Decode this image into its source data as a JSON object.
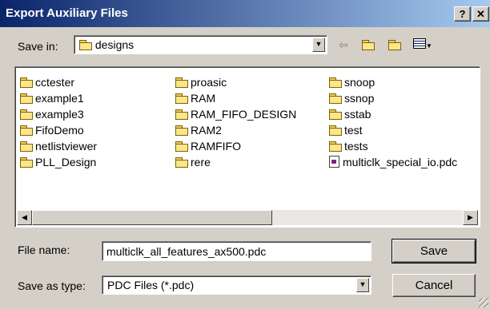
{
  "window": {
    "title": "Export Auxiliary Files",
    "help_label": "?",
    "close_label": "✕"
  },
  "location": {
    "label": "Save in:",
    "current": "designs"
  },
  "toolbar": {
    "back_icon": "back-arrow-icon",
    "up_icon": "up-folder-icon",
    "new_folder_icon": "new-folder-icon",
    "views_icon": "view-menu-icon"
  },
  "files": {
    "col1": [
      "cctester",
      "example1",
      "example3",
      "FifoDemo",
      "netlistviewer",
      "PLL_Design"
    ],
    "col2": [
      "proasic",
      "RAM",
      "RAM_FIFO_DESIGN",
      "RAM2",
      "RAMFIFO",
      "rere"
    ],
    "col3": [
      "snoop",
      "ssnop",
      "sstab",
      "test",
      "tests"
    ],
    "file": "multiclk_special_io.pdc"
  },
  "filename": {
    "label": "File name:",
    "value": "multiclk_all_features_ax500.pdc"
  },
  "filetype": {
    "label": "Save as type:",
    "value": "PDC Files (*.pdc)"
  },
  "buttons": {
    "save": "Save",
    "cancel": "Cancel"
  }
}
